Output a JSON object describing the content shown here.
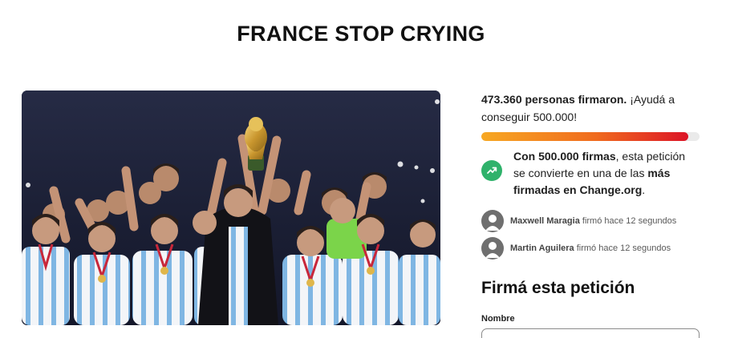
{
  "petition": {
    "title": "FRANCE STOP CRYING",
    "image_icon": "team-celebration-photo"
  },
  "signatures": {
    "count_label": "473.360 personas firmaron.",
    "cta_text": " ¡Ayudá a conseguir 500.000!",
    "progress_fraction": 0.9467,
    "progress_colors": [
      "#f7a823",
      "#f06b1e",
      "#dc1426"
    ]
  },
  "milestone": {
    "icon": "trending-up-icon",
    "icon_color": "#2fb26b",
    "bold_1": "Con 500.000 firmas",
    "text_1": ", esta petición se convierte en una de las ",
    "bold_2": "más firmadas en Change.org",
    "text_2": "."
  },
  "recent_signers": [
    {
      "name": "Maxwell Maragia",
      "action": " firmó hace 12 segundos",
      "icon": "user-avatar-icon"
    },
    {
      "name": "Martin Aguilera",
      "action": " firmó hace 12 segundos",
      "icon": "user-avatar-icon"
    }
  ],
  "sign_form": {
    "heading": "Firmá esta petición",
    "name_label": "Nombre",
    "name_value": ""
  }
}
